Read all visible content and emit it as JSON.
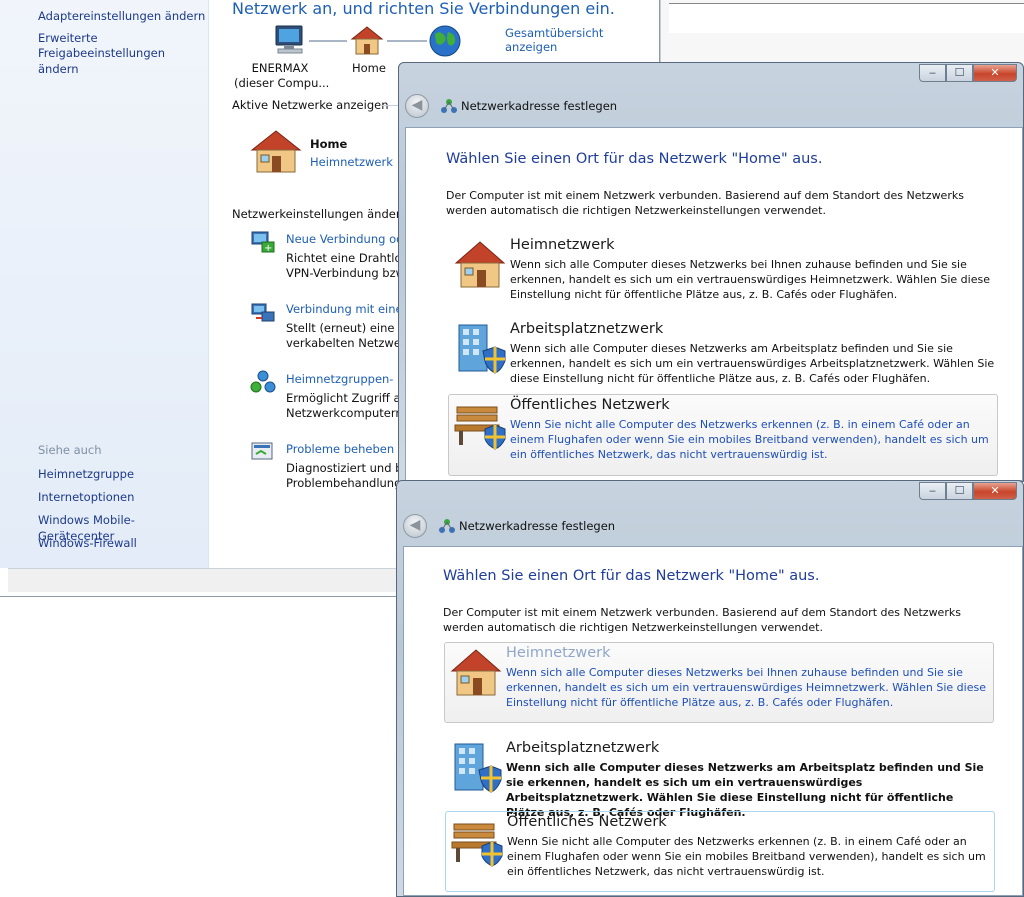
{
  "sidebar": {
    "links_top": [
      "Adaptereinstellungen ändern",
      "Erweiterte",
      "Freigabeeinstellungen ändern"
    ],
    "see_also_heading": "Siehe auch",
    "see_also": [
      "Heimnetzgruppe",
      "Internetoptionen",
      "Windows Mobile-Gerätecenter",
      "Windows-Firewall"
    ]
  },
  "main": {
    "heading": "Netzwerk an, und richten Sie Verbindungen ein.",
    "full_map_link": "Gesamtübersicht anzeigen",
    "map": {
      "computer_name": "ENERMAX",
      "computer_sub": "(dieser Compu...",
      "network_name": "Home"
    },
    "active_networks_label": "Aktive Netzwerke anzeigen",
    "active_network": {
      "name": "Home",
      "type_link": "Heimnetzwerk"
    },
    "change_settings_label": "Netzwerkeinstellungen ändern",
    "tasks": [
      {
        "title": "Neue Verbindung ode",
        "line1": "Richtet eine Drahtlos-",
        "line2": "VPN-Verbindung bzw"
      },
      {
        "title": "Verbindung mit einem",
        "line1": "Stellt (erneut) eine Ver",
        "line2": "verkabelten Netzwerk"
      },
      {
        "title": "Heimnetzgruppen- u",
        "line1": "Ermöglicht Zugriff au",
        "line2": "Netzwerkcomputern z"
      },
      {
        "title": "Probleme beheben",
        "line1": "Diagnostiziert und be",
        "line2": "Problembehandlung"
      }
    ]
  },
  "dialogs": [
    {
      "title": "Netzwerkadresse festlegen",
      "heading": "Wählen Sie einen Ort für das Netzwerk \"Home\" aus.",
      "intro_1": "Der Computer ist mit einem Netzwerk verbunden. Basierend auf dem Standort des Netzwerks",
      "intro_2": "werden automatisch die richtigen Netzwerkeinstellungen verwendet.",
      "options": [
        {
          "title": "Heimnetzwerk",
          "desc": "Wenn sich alle Computer dieses Netzwerks bei Ihnen zuhause befinden und Sie sie erkennen, handelt es sich um ein vertrauenswürdiges Heimnetzwerk. Wählen Sie diese Einstellung nicht für öffentliche Plätze aus, z. B. Cafés oder Flughäfen."
        },
        {
          "title": "Arbeitsplatznetzwerk",
          "desc": "Wenn sich alle Computer dieses Netzwerks am Arbeitsplatz befinden und Sie sie erkennen, handelt es sich um ein vertrauenswürdiges Arbeitsplatznetzwerk. Wählen Sie diese Einstellung nicht für öffentliche Plätze aus, z. B. Cafés oder Flughäfen."
        },
        {
          "title": "Öffentliches Netzwerk",
          "desc": "Wenn Sie nicht alle Computer des Netzwerks erkennen (z. B. in einem Café oder an einem Flughafen oder wenn Sie ein mobiles Breitband verwenden), handelt es sich um ein öffentliches Netzwerk, das nicht vertrauenswürdig ist."
        }
      ]
    },
    {
      "title": "Netzwerkadresse festlegen",
      "heading": "Wählen Sie einen Ort für das Netzwerk \"Home\" aus.",
      "intro_1": "Der Computer ist mit einem Netzwerk verbunden. Basierend auf dem Standort des Netzwerks",
      "intro_2": "werden automatisch die richtigen Netzwerkeinstellungen verwendet.",
      "options": [
        {
          "title": "Heimnetzwerk",
          "desc": "Wenn sich alle Computer dieses Netzwerks bei Ihnen zuhause befinden und Sie sie erkennen, handelt es sich um ein vertrauenswürdiges Heimnetzwerk. Wählen Sie diese Einstellung nicht für öffentliche Plätze aus, z. B. Cafés oder Flughäfen."
        },
        {
          "title": "Arbeitsplatznetzwerk",
          "desc": "Wenn sich alle Computer dieses Netzwerks am Arbeitsplatz befinden und Sie sie erkennen, handelt es sich um ein vertrauenswürdiges Arbeitsplatznetzwerk. Wählen Sie diese Einstellung nicht für öffentliche Plätze aus, z. B. Cafés oder Flughäfen."
        },
        {
          "title": "Öffentliches Netzwerk",
          "desc": "Wenn Sie nicht alle Computer des Netzwerks erkennen (z. B. in einem Café oder an einem Flughafen oder wenn Sie ein mobiles Breitband verwenden), handelt es sich um ein öffentliches Netzwerk, das nicht vertrauenswürdig ist."
        }
      ]
    }
  ],
  "titlebar": {
    "minimize": "‒",
    "maximize": "☐",
    "close": "✕",
    "back": "◀"
  },
  "icons": {
    "computer": "computer-icon",
    "house": "house-icon",
    "globe": "globe-icon",
    "new_connection": "new-connection-icon",
    "connect": "connect-network-icon",
    "homegroup": "homegroup-icon",
    "troubleshoot": "troubleshoot-icon",
    "office": "office-building-icon",
    "bench": "park-bench-icon",
    "shield": "shield-icon"
  },
  "colors": {
    "link": "#1e5fb5",
    "heading": "#1f3d99",
    "selected_text": "#1e4fb8"
  }
}
